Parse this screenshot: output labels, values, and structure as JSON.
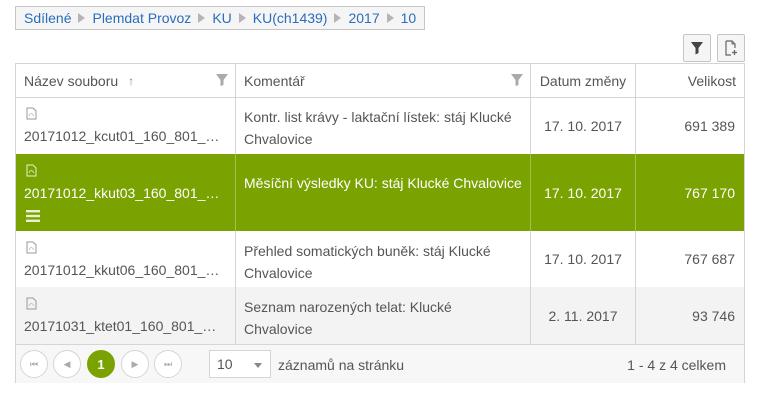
{
  "breadcrumb": [
    "Sdílené",
    "Plemdat Provoz",
    "KU",
    "KU(ch1439)",
    "2017",
    "10"
  ],
  "toolbar": {
    "filter_icon": "filter-icon",
    "new_file_icon": "new-file-icon"
  },
  "columns": {
    "name": "Název souboru",
    "comment": "Komentář",
    "date": "Datum změny",
    "size": "Velikost",
    "sort_arrow": "↑"
  },
  "rows": [
    {
      "file": "20171012_kcut01_160_801_…",
      "comment": "Kontr. list krávy - laktační lístek: stáj Klucké Chvalovice",
      "date": "17. 10. 2017",
      "size": "691 389"
    },
    {
      "file": "20171012_kkut03_160_801_…",
      "comment": "Měsíční výsledky KU: stáj Klucké Chvalovice",
      "date": "17. 10. 2017",
      "size": "767 170"
    },
    {
      "file": "20171012_kkut06_160_801_…",
      "comment": "Přehled somatických buněk: stáj Klucké Chvalovice",
      "date": "17. 10. 2017",
      "size": "767 687"
    },
    {
      "file": "20171031_ktet01_160_801_…",
      "comment": "Seznam narozených telat: Klucké Chvalovice",
      "date": "2. 11. 2017",
      "size": "93 746"
    }
  ],
  "pager": {
    "first": "⏮",
    "prev": "◀",
    "current_page": "1",
    "next": "▶",
    "last": "⏭",
    "page_size": "10",
    "per_page_label": "záznamů na stránku",
    "total_label": "1 - 4 z 4 celkem"
  },
  "colors": {
    "accent": "#7aa200",
    "link": "#2a6ebb"
  }
}
